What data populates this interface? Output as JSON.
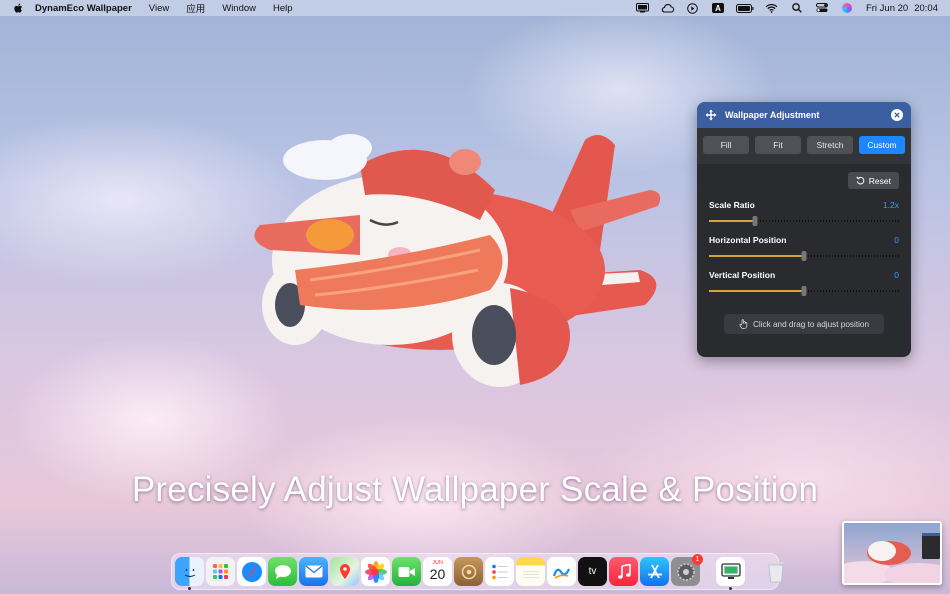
{
  "menubar": {
    "app_name": "DynamEco Wallpaper",
    "menus": [
      "View",
      "应用",
      "Window",
      "Help"
    ],
    "input_indicator": "A",
    "date": "Fri Jun 20",
    "time": "20:04"
  },
  "panel": {
    "title": "Wallpaper Adjustment",
    "modes": [
      "Fill",
      "Fit",
      "Stretch",
      "Custom"
    ],
    "active_mode": "Custom",
    "reset_label": "Reset",
    "sliders": [
      {
        "label": "Scale Ratio",
        "value": "1.2x",
        "fraction": 0.24
      },
      {
        "label": "Horizontal Position",
        "value": "0",
        "fraction": 0.5
      },
      {
        "label": "Vertical Position",
        "value": "0",
        "fraction": 0.5
      }
    ],
    "hint": "Click and drag to adjust position",
    "accent_color": "#1e86ff",
    "header_color": "#3b5fa0"
  },
  "caption": "Precisely Adjust Wallpaper Scale & Position",
  "dock": {
    "calendar_month": "JUN",
    "calendar_day": "20",
    "tv_label": "tv",
    "settings_badge": "1",
    "apps": [
      "finder-icon",
      "launchpad-icon",
      "safari-icon",
      "messages-icon",
      "mail-icon",
      "maps-icon",
      "photos-icon",
      "facetime-icon",
      "calendar-icon",
      "wallpaper-app-icon",
      "reminders-icon",
      "notes-icon",
      "freeform-icon",
      "tv-icon",
      "music-icon",
      "app-store-icon",
      "system-settings-icon",
      "screen-app-icon",
      "trash-icon"
    ]
  }
}
